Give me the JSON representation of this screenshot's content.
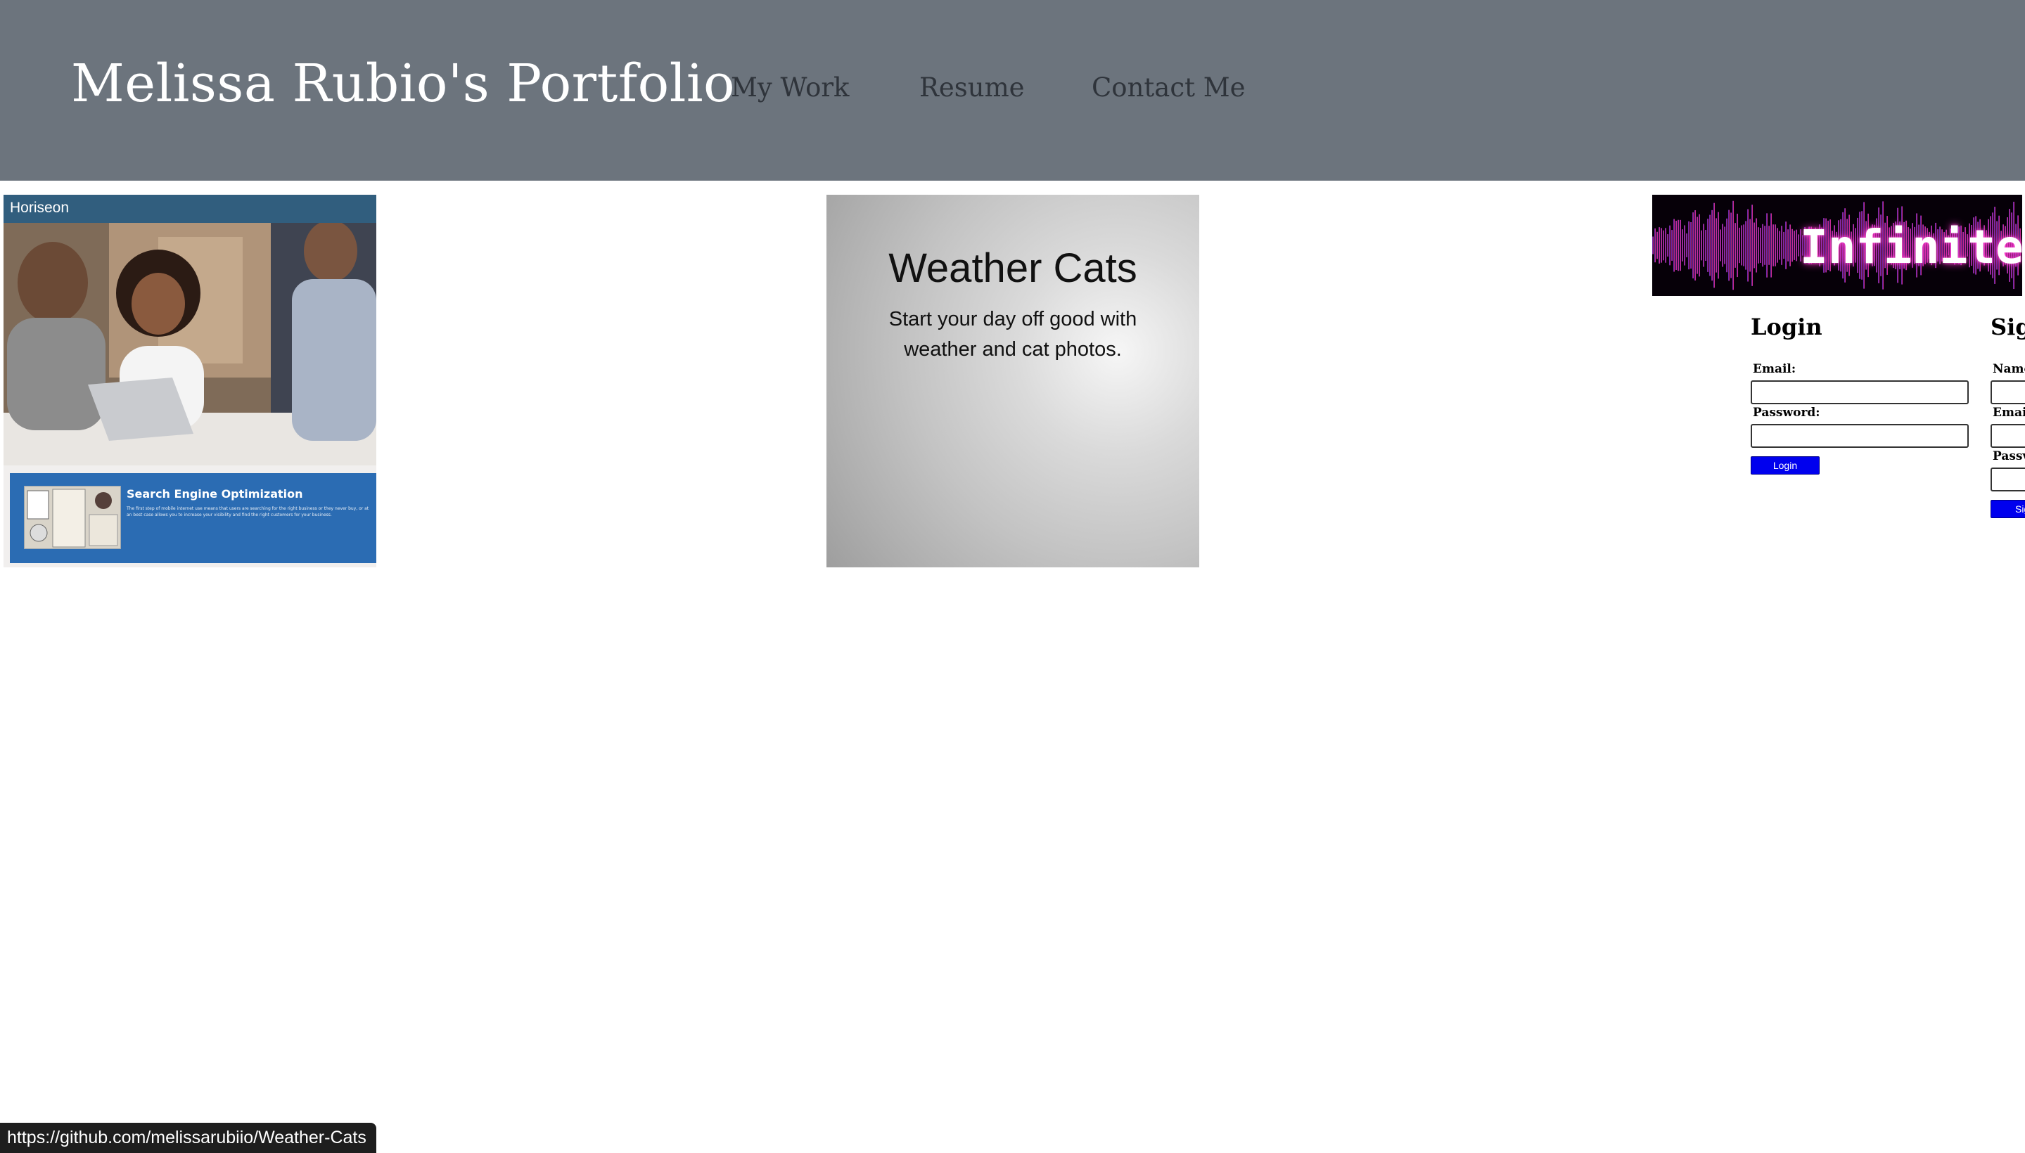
{
  "header": {
    "title": "Melissa Rubio's Portfolio",
    "nav": [
      {
        "label": "My Work"
      },
      {
        "label": "Resume"
      },
      {
        "label": "Contact Me"
      }
    ]
  },
  "projects": {
    "horiseon": {
      "brand": "Horiseon",
      "seo_title": "Search Engine Optimization",
      "seo_text": "The first step of mobile internet use means that users are searching for the right business or they never buy, or at an best case allows you to increase your visibility and find the right customers for your business."
    },
    "weather": {
      "title": "Weather Cats",
      "subtitle": "Start your day off good with weather and cat photos."
    },
    "infinite": {
      "banner_text": "Infinite",
      "login": {
        "heading": "Login",
        "email_label": "Email:",
        "password_label": "Password:",
        "button": "Login"
      },
      "signup": {
        "heading": "Sig",
        "name_label": "Name",
        "email_label": "Emai",
        "password_label": "Passv",
        "button": "Sig"
      }
    }
  },
  "status_bar": {
    "url": "https://github.com/melissarubiio/Weather-Cats"
  },
  "colors": {
    "header_bg": "#6c747d",
    "nav_text": "#2f343b",
    "horiseon_bar": "#315e7e",
    "seo_panel": "#2b6cb3",
    "button_blue": "#0000ee",
    "banner_glow": "#ff33cc"
  }
}
